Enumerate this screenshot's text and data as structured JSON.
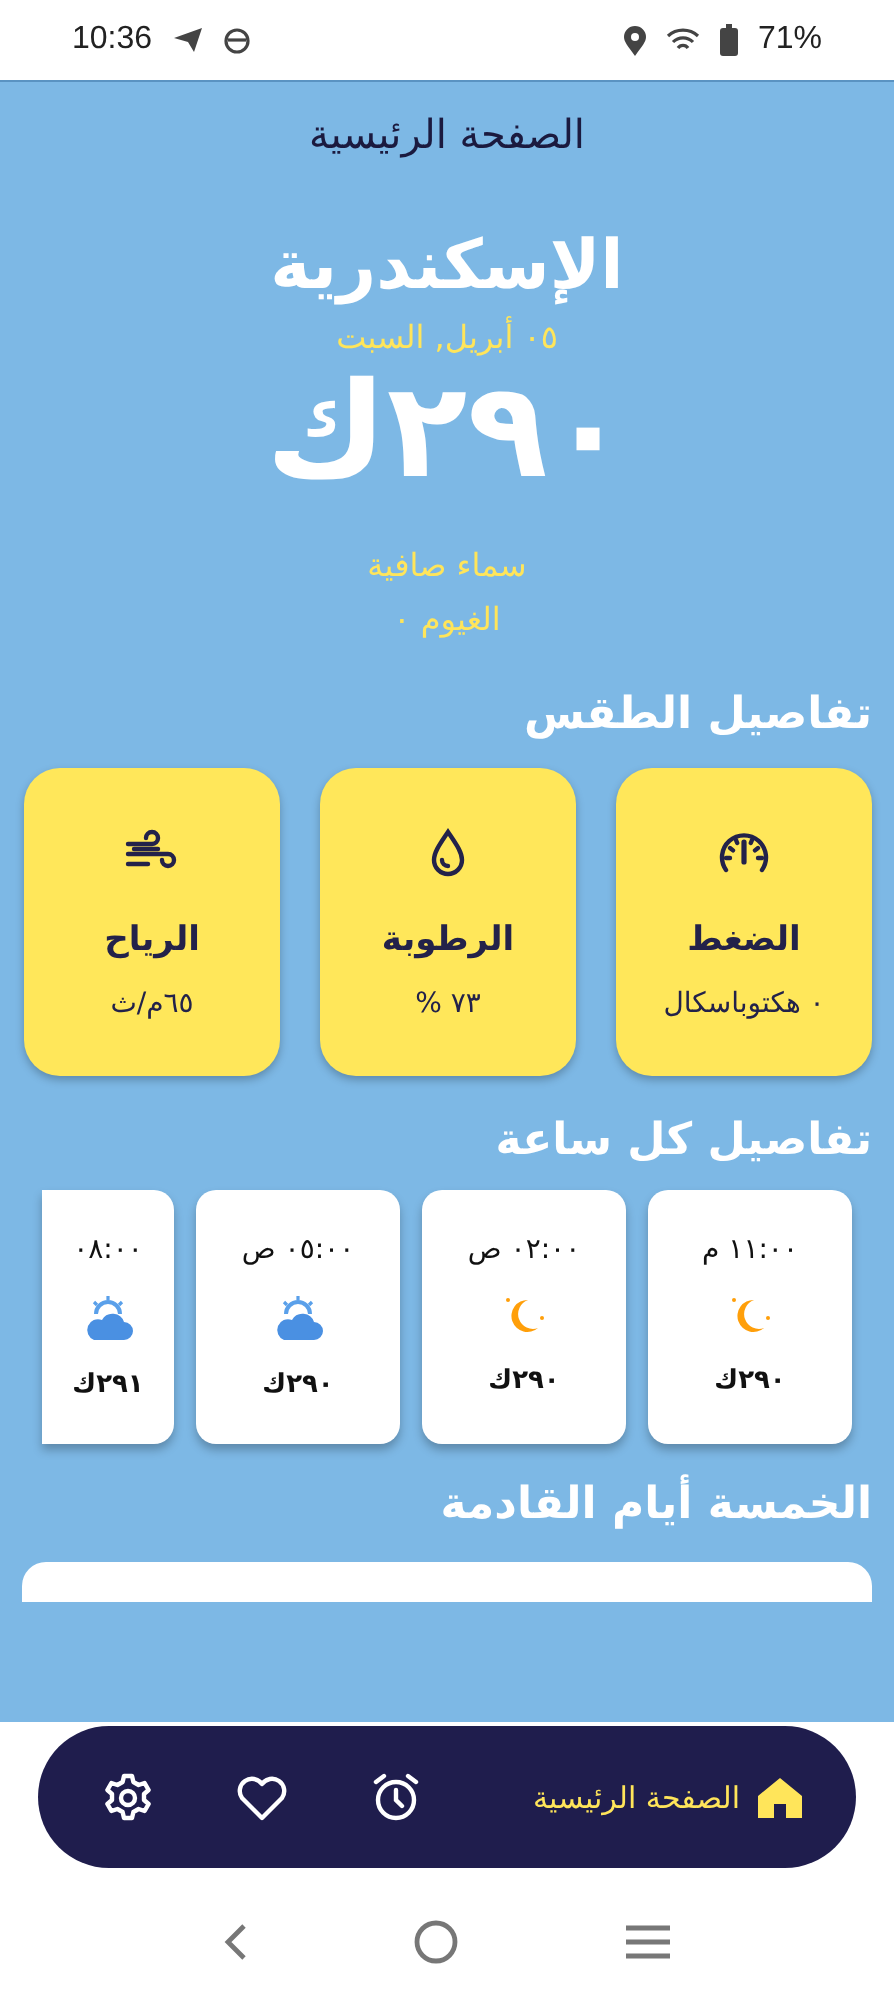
{
  "status_bar": {
    "time": "10:36",
    "battery": "71%"
  },
  "header": {
    "title": "الصفحة الرئيسية"
  },
  "current": {
    "city": "الإسكندرية",
    "date": "٠٥ أبريل, السبت",
    "temperature": "٢٩٠ك",
    "condition": "سماء صافية",
    "clouds": "الغيوم ٠"
  },
  "details": {
    "title": "تفاصيل الطقس",
    "items": [
      {
        "kind": "pressure",
        "label": "الضغط",
        "value": "٠ هكتوباسكال"
      },
      {
        "kind": "humidity",
        "label": "الرطوبة",
        "value": "٧٣ %"
      },
      {
        "kind": "wind",
        "label": "الرياح",
        "value": "٦٥م/ث"
      }
    ]
  },
  "hourly": {
    "title": "تفاصيل كل ساعة",
    "items": [
      {
        "time": "١١:٠٠ م",
        "kind": "night",
        "temperature": "٢٩٠ك"
      },
      {
        "time": "٠٢:٠٠ ص",
        "kind": "night",
        "temperature": "٢٩٠ك"
      },
      {
        "time": "٠٥:٠٠ ص",
        "kind": "cloudy",
        "temperature": "٢٩٠ك"
      },
      {
        "time": "٠٨:٠٠",
        "kind": "cloudy",
        "temperature": "٢٩١ك"
      }
    ]
  },
  "daily": {
    "title": "الخمسة أيام القادمة"
  },
  "nav": {
    "items": [
      {
        "kind": "home",
        "label": "الصفحة الرئيسية",
        "selected": true
      },
      {
        "kind": "alarm",
        "selected": false
      },
      {
        "kind": "favorites",
        "selected": false
      },
      {
        "kind": "settings",
        "selected": false
      }
    ]
  }
}
